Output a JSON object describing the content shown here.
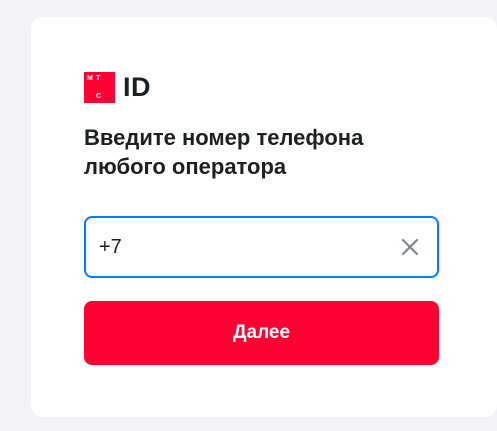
{
  "logo": {
    "mark_letters": [
      "М",
      "Т",
      "С"
    ],
    "text": "ID",
    "brand_color": "#ff0032"
  },
  "heading": {
    "line1": "Введите номер телефона",
    "line2": "любого оператора"
  },
  "phone_field": {
    "value": "+7",
    "focus_color": "#007cff"
  },
  "clear_icon": "close-icon",
  "submit": {
    "label": "Далее"
  }
}
